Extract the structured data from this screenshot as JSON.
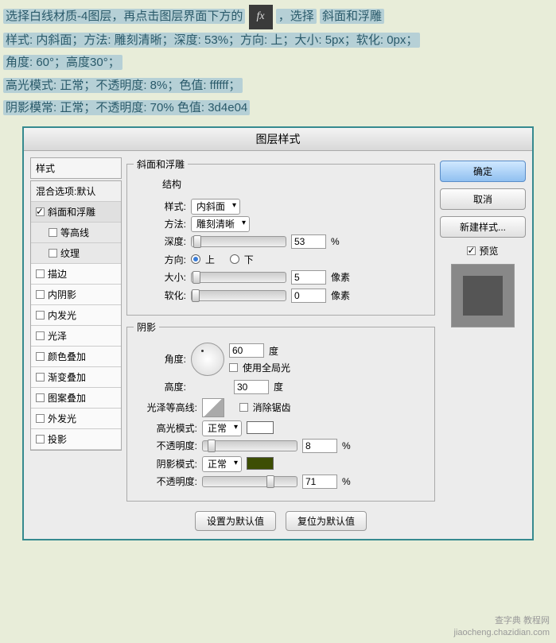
{
  "instructions": {
    "line1_a": "选择白线材质-4图层，再点击图层界面下方的",
    "fx": "fx",
    "line1_b": "，选择",
    "line1_c": "斜面和浮雕",
    "line2": "样式: 内斜面；方法: 雕刻清晰；深度: 53%；方向: 上；大小: 5px；软化: 0px；",
    "line3": "角度: 60°；高度30°；",
    "line4": "高光模式: 正常；不透明度: 8%；色值: ffffff；",
    "line5": "阴影模常: 正常；不透明度: 70%  色值: 3d4e04"
  },
  "dialog": {
    "title": "图层样式",
    "styles_header": "样式",
    "blend_options": "混合选项:默认",
    "items": [
      {
        "label": "斜面和浮雕",
        "checked": true,
        "selected": true
      },
      {
        "label": "等高线",
        "checked": false,
        "sub": true
      },
      {
        "label": "纹理",
        "checked": false,
        "sub": true
      },
      {
        "label": "描边",
        "checked": false
      },
      {
        "label": "内阴影",
        "checked": false
      },
      {
        "label": "内发光",
        "checked": false
      },
      {
        "label": "光泽",
        "checked": false
      },
      {
        "label": "颜色叠加",
        "checked": false
      },
      {
        "label": "渐变叠加",
        "checked": false
      },
      {
        "label": "图案叠加",
        "checked": false
      },
      {
        "label": "外发光",
        "checked": false
      },
      {
        "label": "投影",
        "checked": false
      }
    ]
  },
  "bevel": {
    "group_title": "斜面和浮雕",
    "structure": "结构",
    "style_label": "样式:",
    "style_value": "内斜面",
    "method_label": "方法:",
    "method_value": "雕刻清晰",
    "depth_label": "深度:",
    "depth_value": "53",
    "percent": "%",
    "direction_label": "方向:",
    "up": "上",
    "down": "下",
    "size_label": "大小:",
    "size_value": "5",
    "pixels": "像素",
    "soften_label": "软化:",
    "soften_value": "0"
  },
  "shading": {
    "group_title": "阴影",
    "angle_label": "角度:",
    "angle_value": "60",
    "degree": "度",
    "global_light": "使用全局光",
    "altitude_label": "高度:",
    "altitude_value": "30",
    "gloss_contour_label": "光泽等高线:",
    "antialias": "消除锯齿",
    "highlight_mode_label": "高光模式:",
    "highlight_mode_value": "正常",
    "highlight_color": "#ffffff",
    "highlight_opacity_label": "不透明度:",
    "highlight_opacity_value": "8",
    "shadow_mode_label": "阴影模式:",
    "shadow_mode_value": "正常",
    "shadow_color": "#3d4e04",
    "shadow_opacity_label": "不透明度:",
    "shadow_opacity_value": "71"
  },
  "buttons": {
    "ok": "确定",
    "cancel": "取消",
    "new_style": "新建样式...",
    "preview": "预览",
    "set_default": "设置为默认值",
    "reset_default": "复位为默认值"
  },
  "watermark": {
    "l1": "查字典  教程网",
    "l2": "jiaocheng.chazidian.com"
  }
}
